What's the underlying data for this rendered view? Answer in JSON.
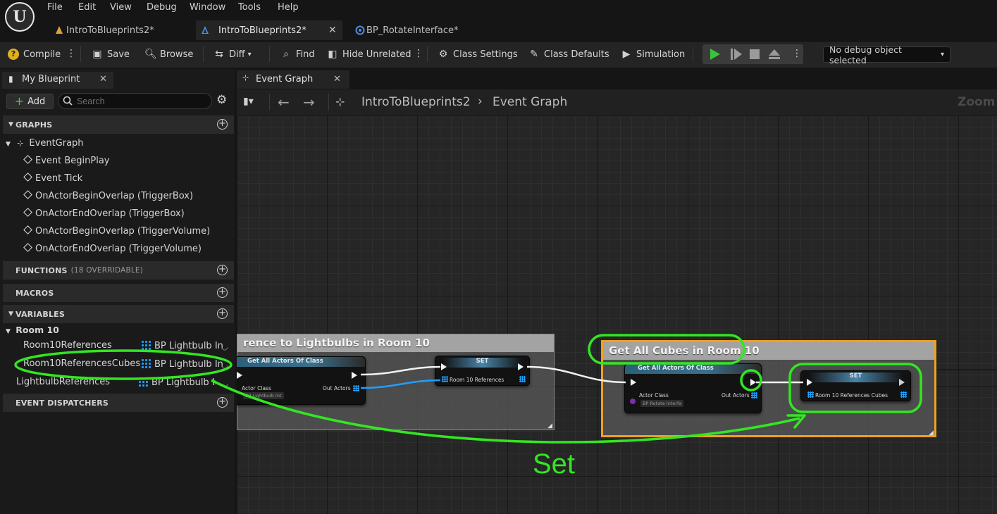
{
  "menu": {
    "items": [
      "File",
      "Edit",
      "View",
      "Debug",
      "Window",
      "Tools",
      "Help"
    ]
  },
  "doc_tabs": [
    {
      "label": "IntroToBlueprints2*",
      "icon": "blueprint-class-icon"
    },
    {
      "label": "IntroToBlueprints2*",
      "icon": "blueprint-icon"
    },
    {
      "label": "BP_RotateInterface*",
      "icon": "interface-icon"
    }
  ],
  "toolbar": {
    "compile": "Compile",
    "save": "Save",
    "browse": "Browse",
    "diff": "Diff",
    "find": "Find",
    "hide_unrelated": "Hide Unrelated",
    "class_settings": "Class Settings",
    "class_defaults": "Class Defaults",
    "simulation": "Simulation",
    "debug_object": "No debug object selected"
  },
  "my_blueprint": {
    "tab_label": "My Blueprint",
    "add_label": "Add",
    "search_placeholder": "Search",
    "graphs_header": "GRAPHS",
    "event_graph": "EventGraph",
    "events": [
      "Event BeginPlay",
      "Event Tick",
      "OnActorBeginOverlap (TriggerBox)",
      "OnActorEndOverlap (TriggerBox)",
      "OnActorBeginOverlap (TriggerVolume)",
      "OnActorEndOverlap (TriggerVolume)"
    ],
    "functions_header": "FUNCTIONS",
    "functions_count": "(18 OVERRIDABLE)",
    "macros_header": "MACROS",
    "variables_header": "VARIABLES",
    "category": "Room 10",
    "variables": [
      {
        "name": "Room10References",
        "type": "BP Lightbulb In"
      },
      {
        "name": "Room10ReferencesCubes",
        "type": "BP Lightbulb In"
      },
      {
        "name": "LightbulbReferences",
        "type": "BP Lightbulb In"
      }
    ],
    "dispatchers_header": "EVENT DISPATCHERS"
  },
  "graph": {
    "tab_label": "Event Graph",
    "breadcrumb_root": "IntroToBlueprints2",
    "breadcrumb_current": "Event Graph",
    "zoom_label": "Zoom -",
    "comment1_title": "rence to Lightbulbs in Room 10",
    "comment2_title": "Get All Cubes in Room 10",
    "node_get_all_1": {
      "title": "Get All Actors Of Class",
      "actor_class_label": "Actor Class",
      "actor_class_value": "BP Lightbulb Int",
      "out_actors_label": "Out Actors"
    },
    "node_set_1": {
      "title": "SET",
      "var": "Room 10 References"
    },
    "node_get_all_2": {
      "title": "Get All Actors Of Class",
      "actor_class_label": "Actor Class",
      "actor_class_value": "BP Rotate Interfa",
      "out_actors_label": "Out Actors"
    },
    "node_set_2": {
      "title": "SET",
      "var": "Room 10 References Cubes"
    }
  },
  "annotation": {
    "label": "Set",
    "color": "#33e622"
  }
}
